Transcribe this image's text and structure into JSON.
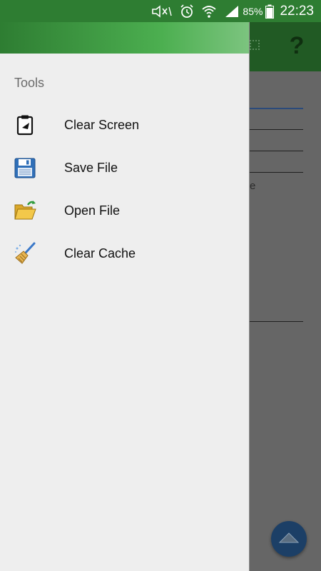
{
  "status_bar": {
    "battery": "85%",
    "time": "22:23",
    "icons": [
      "mute-icon",
      "alarm-icon",
      "wifi-icon",
      "signal-icon",
      "battery-icon"
    ]
  },
  "drawer": {
    "section_title": "Tools",
    "items": [
      {
        "label": "Clear Screen",
        "icon": "clipboard-icon"
      },
      {
        "label": "Save File",
        "icon": "floppy-disk-icon"
      },
      {
        "label": "Open File",
        "icon": "open-folder-icon"
      },
      {
        "label": "Clear Cache",
        "icon": "broom-icon"
      }
    ]
  },
  "background_app": {
    "toolbar_icons": [
      "grid-icon",
      "help-icon"
    ],
    "visible_fragment": "e",
    "fab_icon": "chevron-up-icon",
    "colors": {
      "toolbar": "#2e7d32",
      "fab": "#1c3f66"
    }
  }
}
